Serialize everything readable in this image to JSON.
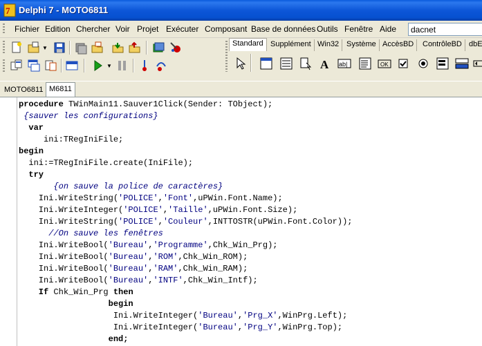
{
  "window": {
    "title": "Delphi 7 - MOTO6811"
  },
  "menu": {
    "items": [
      {
        "label": "Fichier"
      },
      {
        "label": "Edition"
      },
      {
        "label": "Chercher"
      },
      {
        "label": "Voir"
      },
      {
        "label": "Projet"
      },
      {
        "label": "Exécuter"
      },
      {
        "label": "Composant"
      },
      {
        "label": "Base de données"
      },
      {
        "label": "Outils"
      },
      {
        "label": "Fenêtre"
      },
      {
        "label": "Aide"
      }
    ],
    "search_value": "dacnet"
  },
  "palette": {
    "tabs": [
      {
        "label": "Standard",
        "active": true
      },
      {
        "label": "Supplément"
      },
      {
        "label": "Win32"
      },
      {
        "label": "Système"
      },
      {
        "label": "AccèsBD"
      },
      {
        "label": "ContrôleBD"
      },
      {
        "label": "dbE"
      }
    ]
  },
  "editor": {
    "tabs": [
      {
        "label": "MOTO6811"
      },
      {
        "label": "M6811",
        "active": true
      }
    ],
    "code": [
      [
        [
          "kw",
          "procedure"
        ],
        [
          "txt",
          " TWinMain11.Sauver1Click(Sender: TObject);"
        ]
      ],
      [
        [
          "txt",
          " "
        ],
        [
          "cmt",
          "{sauver les configurations}"
        ]
      ],
      [
        [
          "kw",
          "  var"
        ]
      ],
      [
        [
          "txt",
          "     ini:TRegIniFile;"
        ]
      ],
      [
        [
          "kw",
          "begin"
        ]
      ],
      [
        [
          "txt",
          "  ini:=TRegIniFile.create(IniFile);"
        ]
      ],
      [
        [
          "kw",
          "  try"
        ]
      ],
      [
        [
          "txt",
          "       "
        ],
        [
          "cmt",
          "{on sauve la police de caractères}"
        ]
      ],
      [
        [
          "txt",
          "    Ini.WriteString("
        ],
        [
          "str",
          "'POLICE'"
        ],
        [
          "txt",
          ","
        ],
        [
          "str",
          "'Font'"
        ],
        [
          "txt",
          ",uPWin.Font.Name);"
        ]
      ],
      [
        [
          "txt",
          "    Ini.WriteInteger("
        ],
        [
          "str",
          "'POLICE'"
        ],
        [
          "txt",
          ","
        ],
        [
          "str",
          "'Taille'"
        ],
        [
          "txt",
          ",uPWin.Font.Size);"
        ]
      ],
      [
        [
          "txt",
          "    Ini.WriteString("
        ],
        [
          "str",
          "'POLICE'"
        ],
        [
          "txt",
          ","
        ],
        [
          "str",
          "'Couleur'"
        ],
        [
          "txt",
          ",INTTOSTR(uPWin.Font.Color));"
        ]
      ],
      [
        [
          "txt",
          "      "
        ],
        [
          "cmt",
          "//On sauve les fenêtres"
        ]
      ],
      [
        [
          "txt",
          "    Ini.WriteBool("
        ],
        [
          "str",
          "'Bureau'"
        ],
        [
          "txt",
          ","
        ],
        [
          "str",
          "'Programme'"
        ],
        [
          "txt",
          ",Chk_Win_Prg);"
        ]
      ],
      [
        [
          "txt",
          "    Ini.WriteBool("
        ],
        [
          "str",
          "'Bureau'"
        ],
        [
          "txt",
          ","
        ],
        [
          "str",
          "'ROM'"
        ],
        [
          "txt",
          ",Chk_Win_ROM);"
        ]
      ],
      [
        [
          "txt",
          "    Ini.WriteBool("
        ],
        [
          "str",
          "'Bureau'"
        ],
        [
          "txt",
          ","
        ],
        [
          "str",
          "'RAM'"
        ],
        [
          "txt",
          ",Chk_Win_RAM);"
        ]
      ],
      [
        [
          "txt",
          "    Ini.WriteBool("
        ],
        [
          "str",
          "'Bureau'"
        ],
        [
          "txt",
          ","
        ],
        [
          "str",
          "'INTF'"
        ],
        [
          "txt",
          ",Chk_Win_Intf);"
        ]
      ],
      [
        [
          "kw",
          "    If"
        ],
        [
          "txt",
          " Chk_Win_Prg "
        ],
        [
          "kw",
          "then"
        ]
      ],
      [
        [
          "kw",
          "                  begin"
        ]
      ],
      [
        [
          "txt",
          "                   Ini.WriteInteger("
        ],
        [
          "str",
          "'Bureau'"
        ],
        [
          "txt",
          ","
        ],
        [
          "str",
          "'Prg_X'"
        ],
        [
          "txt",
          ",WinPrg.Left);"
        ]
      ],
      [
        [
          "txt",
          "                   Ini.WriteInteger("
        ],
        [
          "str",
          "'Bureau'"
        ],
        [
          "txt",
          ","
        ],
        [
          "str",
          "'Prg_Y'"
        ],
        [
          "txt",
          ",WinPrg.Top);"
        ]
      ],
      [
        [
          "kw",
          "                  end;"
        ]
      ]
    ]
  },
  "colors": {
    "title_bar": "#0a56d8",
    "background": "#ece9d8",
    "comment": "#000080",
    "string": "#000080"
  },
  "icons": [
    "delphi-icon",
    "new-icon",
    "open-icon",
    "save-icon",
    "save-all-icon",
    "open-project-icon",
    "add-file-icon",
    "remove-file-icon",
    "help-icon",
    "view-unit-icon",
    "view-form-icon",
    "toggle-form-unit-icon",
    "new-form-icon",
    "run-icon",
    "pause-icon",
    "trace-into-icon",
    "step-over-icon",
    "pointer-icon"
  ]
}
